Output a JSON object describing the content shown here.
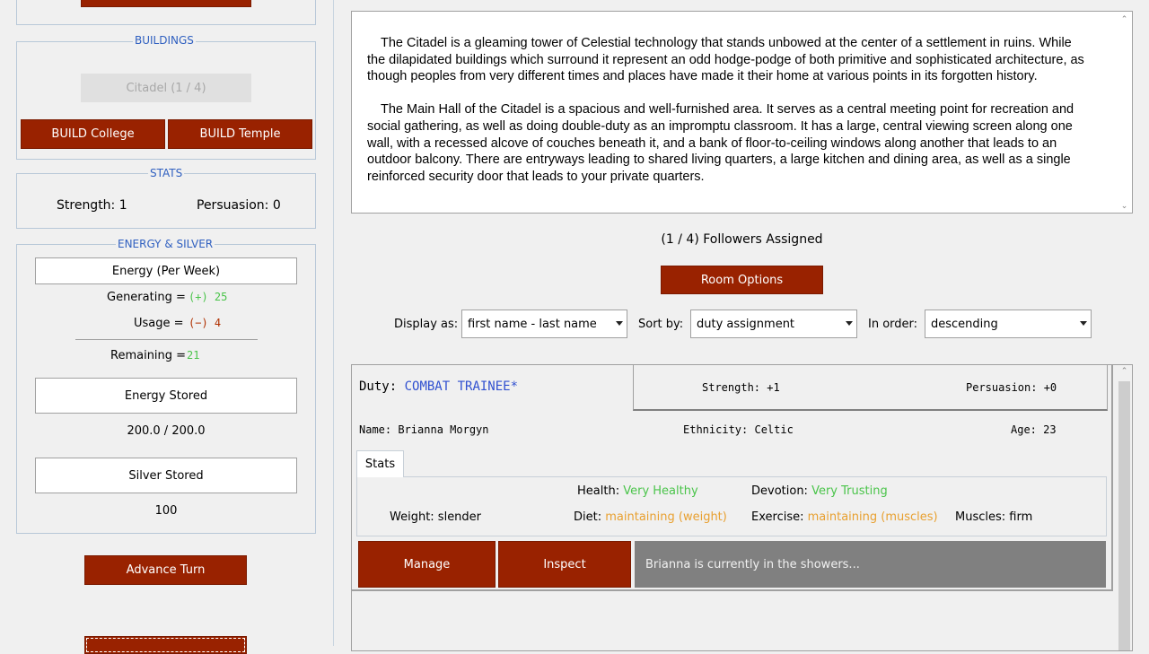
{
  "sidebar": {
    "buildings": {
      "legend": "BUILDINGS",
      "current": "Citadel (1 / 4)",
      "build_college": "BUILD College",
      "build_temple": "BUILD Temple"
    },
    "stats": {
      "legend": "STATS",
      "strength": "Strength: 1",
      "persuasion": "Persuasion: 0"
    },
    "energy": {
      "legend": "ENERGY & SILVER",
      "per_week_label": "Energy (Per Week)",
      "generating_label": "Generating =",
      "generating_value": "(+) 25",
      "usage_label": "Usage =",
      "usage_value": "(−) 4",
      "remaining_label": "Remaining =",
      "remaining_value": "21",
      "stored_label": "Energy Stored",
      "stored_value": "200.0 / 200.0",
      "silver_label": "Silver Stored",
      "silver_value": "100"
    },
    "advance_turn": "Advance Turn"
  },
  "description": {
    "p1": "The Citadel is a gleaming tower of Celestial technology that stands unbowed at the center of a settlement in ruins. While the dilapidated buildings which surround it represent an odd hodge-podge of both primitive and sophisticated architecture, as though peoples from very different times and places have made it their home at various points in its forgotten history.",
    "p2": "The Main Hall of the Citadel is a spacious and well-furnished area. It serves as a central meeting point for recreation and social gathering, as well as doing double-duty as an impromptu classroom. It has a large, central viewing screen along one wall, with a recessed alcove of couches beneath it, and a bank of floor-to-ceiling windows along another that leads to an outdoor balcony. There are entryways leading to shared living quarters, a large kitchen and dining area, as well as a single reinforced security door that leads to your private quarters."
  },
  "followers_assigned": "(1 / 4) Followers Assigned",
  "room_options": "Room Options",
  "controls": {
    "display_label": "Display as:",
    "display_value": "first name - last name",
    "sort_label": "Sort by:",
    "sort_value": "duty assignment",
    "order_label": "In order:",
    "order_value": "descending"
  },
  "follower": {
    "duty_label": "Duty:",
    "duty_value": "COMBAT TRAINEE*",
    "strength": "Strength: +1",
    "persuasion": "Persuasion: +0",
    "name_label": "Name:",
    "name_value": "Brianna Morgyn",
    "ethnicity_label": "Ethnicity:",
    "ethnicity_value": "Celtic",
    "age_label": "Age:",
    "age_value": "23",
    "tab_stats": "Stats",
    "health_label": "Health:",
    "health_value": "Very Healthy",
    "devotion_label": "Devotion:",
    "devotion_value": "Very Trusting",
    "weight": "Weight: slender",
    "diet_label": "Diet:",
    "diet_value": "maintaining (weight)",
    "exercise_label": "Exercise:",
    "exercise_value": "maintaining (muscles)",
    "muscles": "Muscles: firm",
    "manage": "Manage",
    "inspect": "Inspect",
    "status": "Brianna is currently in the showers..."
  },
  "colors": {
    "button_red": "#992200",
    "legend_blue": "#3060c0",
    "positive_green": "#4ac44a",
    "warning_orange": "#e8a030",
    "status_gray": "#808080"
  }
}
